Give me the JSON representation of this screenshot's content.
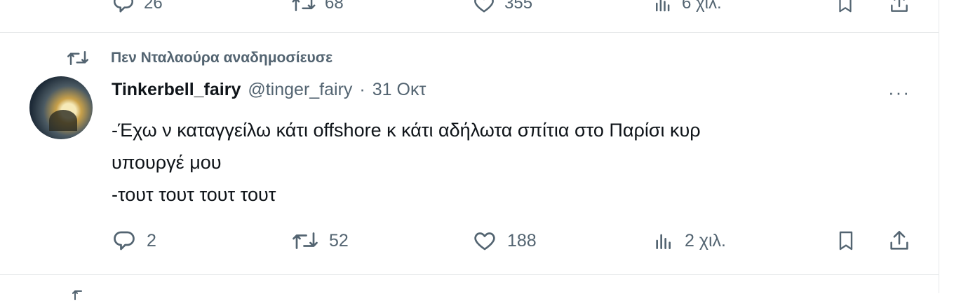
{
  "previous_tweet": {
    "reply_count": "26",
    "retweet_count": "68",
    "like_count": "355",
    "view_count": "6 χιλ."
  },
  "tweet": {
    "social_context": "Πεν Νταλαούρα αναδημοσίευσε",
    "author_name": "Tinkerbell_fairy",
    "author_handle": "@tinger_fairy",
    "separator": "·",
    "date": "31 Οκτ",
    "more_label": "···",
    "body_lines": [
      "-Έχω ν καταγγείλω κάτι offshore  κ κάτι αδήλωτα σπίτια στο Παρίσι κυρ",
      "υπουργέ μου",
      "-τουτ τουτ τουτ τουτ"
    ],
    "actions": {
      "reply_count": "2",
      "retweet_count": "52",
      "like_count": "188",
      "view_count": "2 χιλ."
    }
  },
  "icons": {
    "reply": "reply-icon",
    "retweet": "retweet-icon",
    "like": "heart-icon",
    "views": "bar-chart-icon",
    "bookmark": "bookmark-icon",
    "share": "share-icon",
    "more": "more-icon"
  },
  "colors": {
    "text": "#0f1419",
    "secondary": "#536471",
    "border": "#e7e9ea"
  }
}
